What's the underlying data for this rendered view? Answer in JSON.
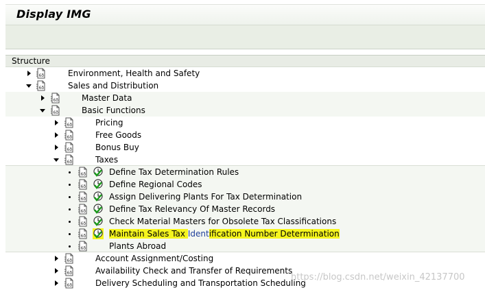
{
  "window": {
    "title": "Display IMG"
  },
  "structure_header": "Structure",
  "tree": {
    "environment": "Environment, Health and Safety",
    "sales_distribution": "Sales and Distribution",
    "master_data": "Master Data",
    "basic_functions": "Basic Functions",
    "pricing": "Pricing",
    "free_goods": "Free Goods",
    "bonus_buy": "Bonus Buy",
    "taxes": "Taxes",
    "define_tax_rules": "Define Tax Determination Rules",
    "define_regional_codes": "Define Regional Codes",
    "assign_plants": "Assign Delivering Plants For Tax Determination",
    "tax_relevancy": "Define Tax Relevancy Of Master Records",
    "check_materials": "Check Material Masters for Obsolete Tax Classifications",
    "maintain_sales_tax_a": "Maintain Sales Tax ",
    "maintain_sales_tax_b": "Ident",
    "maintain_sales_tax_c": "ification Number Determination",
    "plants_abroad": "Plants Abroad",
    "account_assignment": "Account Assignment/Costing",
    "availability_check": "Availability Check and Transfer of Requirements",
    "delivery_scheduling": "Delivery Scheduling and Transportation Scheduling"
  },
  "colors": {
    "highlight": "#f5f51e",
    "link_blue": "#1f3f9a",
    "toolbar": "#e9eee5"
  },
  "watermark": "https://blog.csdn.net/weixin_42137700"
}
